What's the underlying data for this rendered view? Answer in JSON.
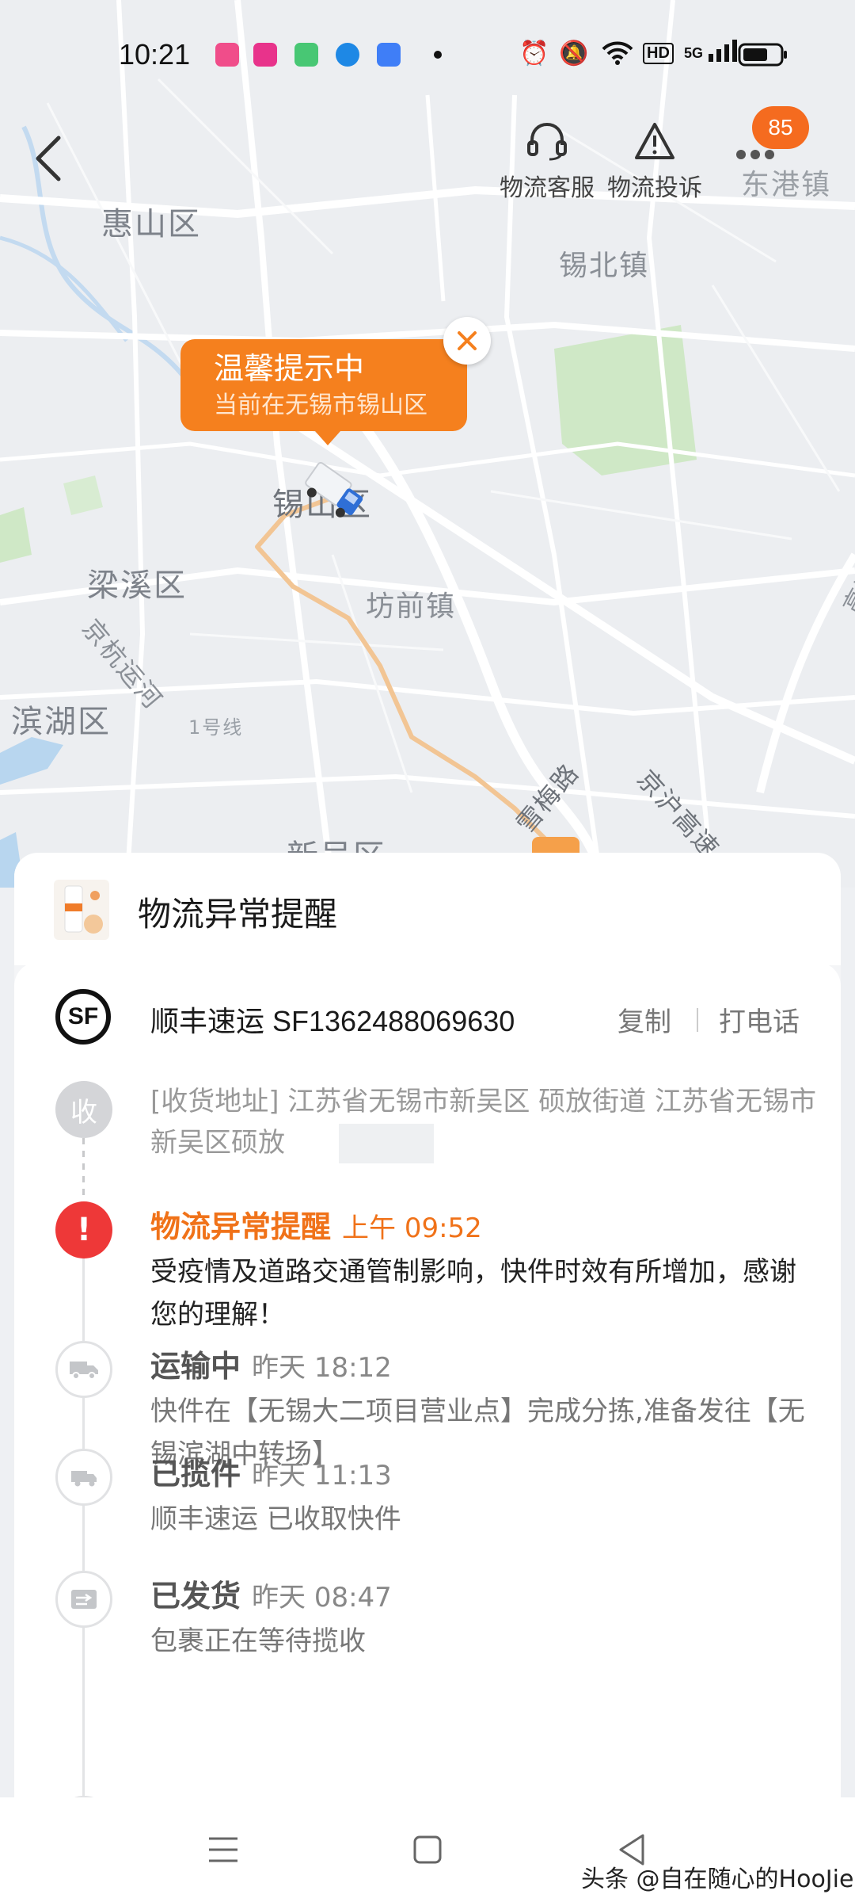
{
  "status_bar": {
    "time": "10:21",
    "icons": [
      "app-icon",
      "app-icon",
      "app-icon",
      "app-icon",
      "app-icon",
      "dot-icon",
      "alarm-icon",
      "mute-icon",
      "wifi-icon",
      "hd-icon",
      "signal-5g-icon",
      "battery-icon"
    ],
    "hd": "HD",
    "net": "5G"
  },
  "map": {
    "labels": {
      "huishan": "惠山区",
      "xibei": "锡北镇",
      "donggang": "东港镇",
      "xishan": "锡山区",
      "liangxi": "梁溪区",
      "jinghang": "京杭运河",
      "fangqian": "坊前镇",
      "binhu": "滨湖区",
      "line1": "1号线",
      "xuemei": "雪梅路",
      "jinghu": "京沪高速",
      "xinwu": "新吴区",
      "gaosu": "高速"
    },
    "tip": {
      "title": "温馨提示中",
      "subtitle": "当前在无锡市锡山区"
    }
  },
  "top_bar": {
    "service_label": "物流客服",
    "complaint_label": "物流投诉",
    "badge_count": "85"
  },
  "alert": {
    "title": "物流异常提醒"
  },
  "carrier": {
    "logo_text": "SF",
    "name_and_number": "顺丰速运 SF1362488069630",
    "copy_label": "复制",
    "call_label": "打电话"
  },
  "address": {
    "node_label": "收",
    "text": "[收货地址] 江苏省无锡市新吴区 硕放街道   江苏省无锡市新吴区硕放"
  },
  "timeline": [
    {
      "status": "物流异常提醒",
      "time": "上午 09:52",
      "desc": "受疫情及道路交通管制影响，快件时效有所增加，感谢您的理解！",
      "icon": "exclamation-icon"
    },
    {
      "status": "运输中",
      "time": "昨天 18:12",
      "desc": "快件在【无锡大二项目营业点】完成分拣,准备发往【无锡滨湖中转场】",
      "icon": "truck-icon"
    },
    {
      "status": "已揽件",
      "time": "昨天 11:13",
      "desc": "顺丰速运 已收取快件",
      "icon": "pickup-truck-icon"
    },
    {
      "status": "已发货",
      "time": "昨天 08:47",
      "desc": "包裹正在等待揽收",
      "icon": "shipped-box-icon"
    }
  ],
  "watermark": "头条 @自在随心的HooJie",
  "colors": {
    "accent_orange": "#f5801e",
    "alert_red": "#ee3838",
    "route": "#f2c594"
  }
}
